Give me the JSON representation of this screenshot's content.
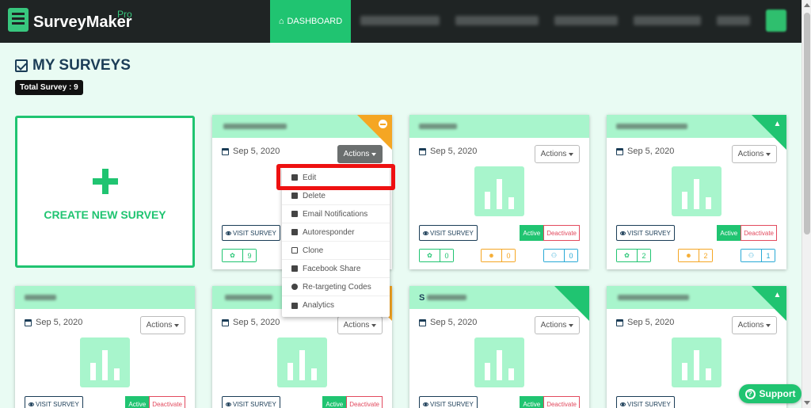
{
  "app": {
    "name": "SurveyMaker",
    "edition": "Pro"
  },
  "nav": {
    "dashboard": "DASHBOARD"
  },
  "page": {
    "title": "MY SURVEYS",
    "total": "Total Survey : 9"
  },
  "create": {
    "label": "CREATE NEW SURVEY"
  },
  "common": {
    "actions": "Actions",
    "visit": "VISIT SURVEY",
    "active": "Active",
    "deactivate": "Deactivate",
    "date": "Sep 5, 2020"
  },
  "cards": [
    {
      "title_prefix": "",
      "stats": [
        "9"
      ],
      "status": "orange"
    },
    {
      "title_prefix": "",
      "stats": [
        "0",
        "0",
        "0"
      ],
      "status": "none"
    },
    {
      "title_prefix": "",
      "stats": [
        "2",
        "2",
        "1"
      ],
      "status": "green"
    },
    {
      "title_prefix": "",
      "stats": [],
      "status": "none"
    },
    {
      "title_prefix": "",
      "stats": [],
      "status": "orange"
    },
    {
      "title_prefix": "S",
      "stats": [],
      "status": "green"
    },
    {
      "title_prefix": "",
      "stats": [],
      "status": "green"
    }
  ],
  "dropdown": {
    "items": [
      "Edit",
      "Delete",
      "Email Notifications",
      "Autoresponder",
      "Clone",
      "Facebook Share",
      "Re-targeting Codes",
      "Analytics"
    ]
  },
  "support": {
    "label": "Support",
    "icon": "?"
  },
  "colors": {
    "accent": "#20c471",
    "topbar": "#1f2424",
    "header_tint": "#a8f5cc",
    "danger": "#e24a5e",
    "highlight": "#ee1111"
  }
}
